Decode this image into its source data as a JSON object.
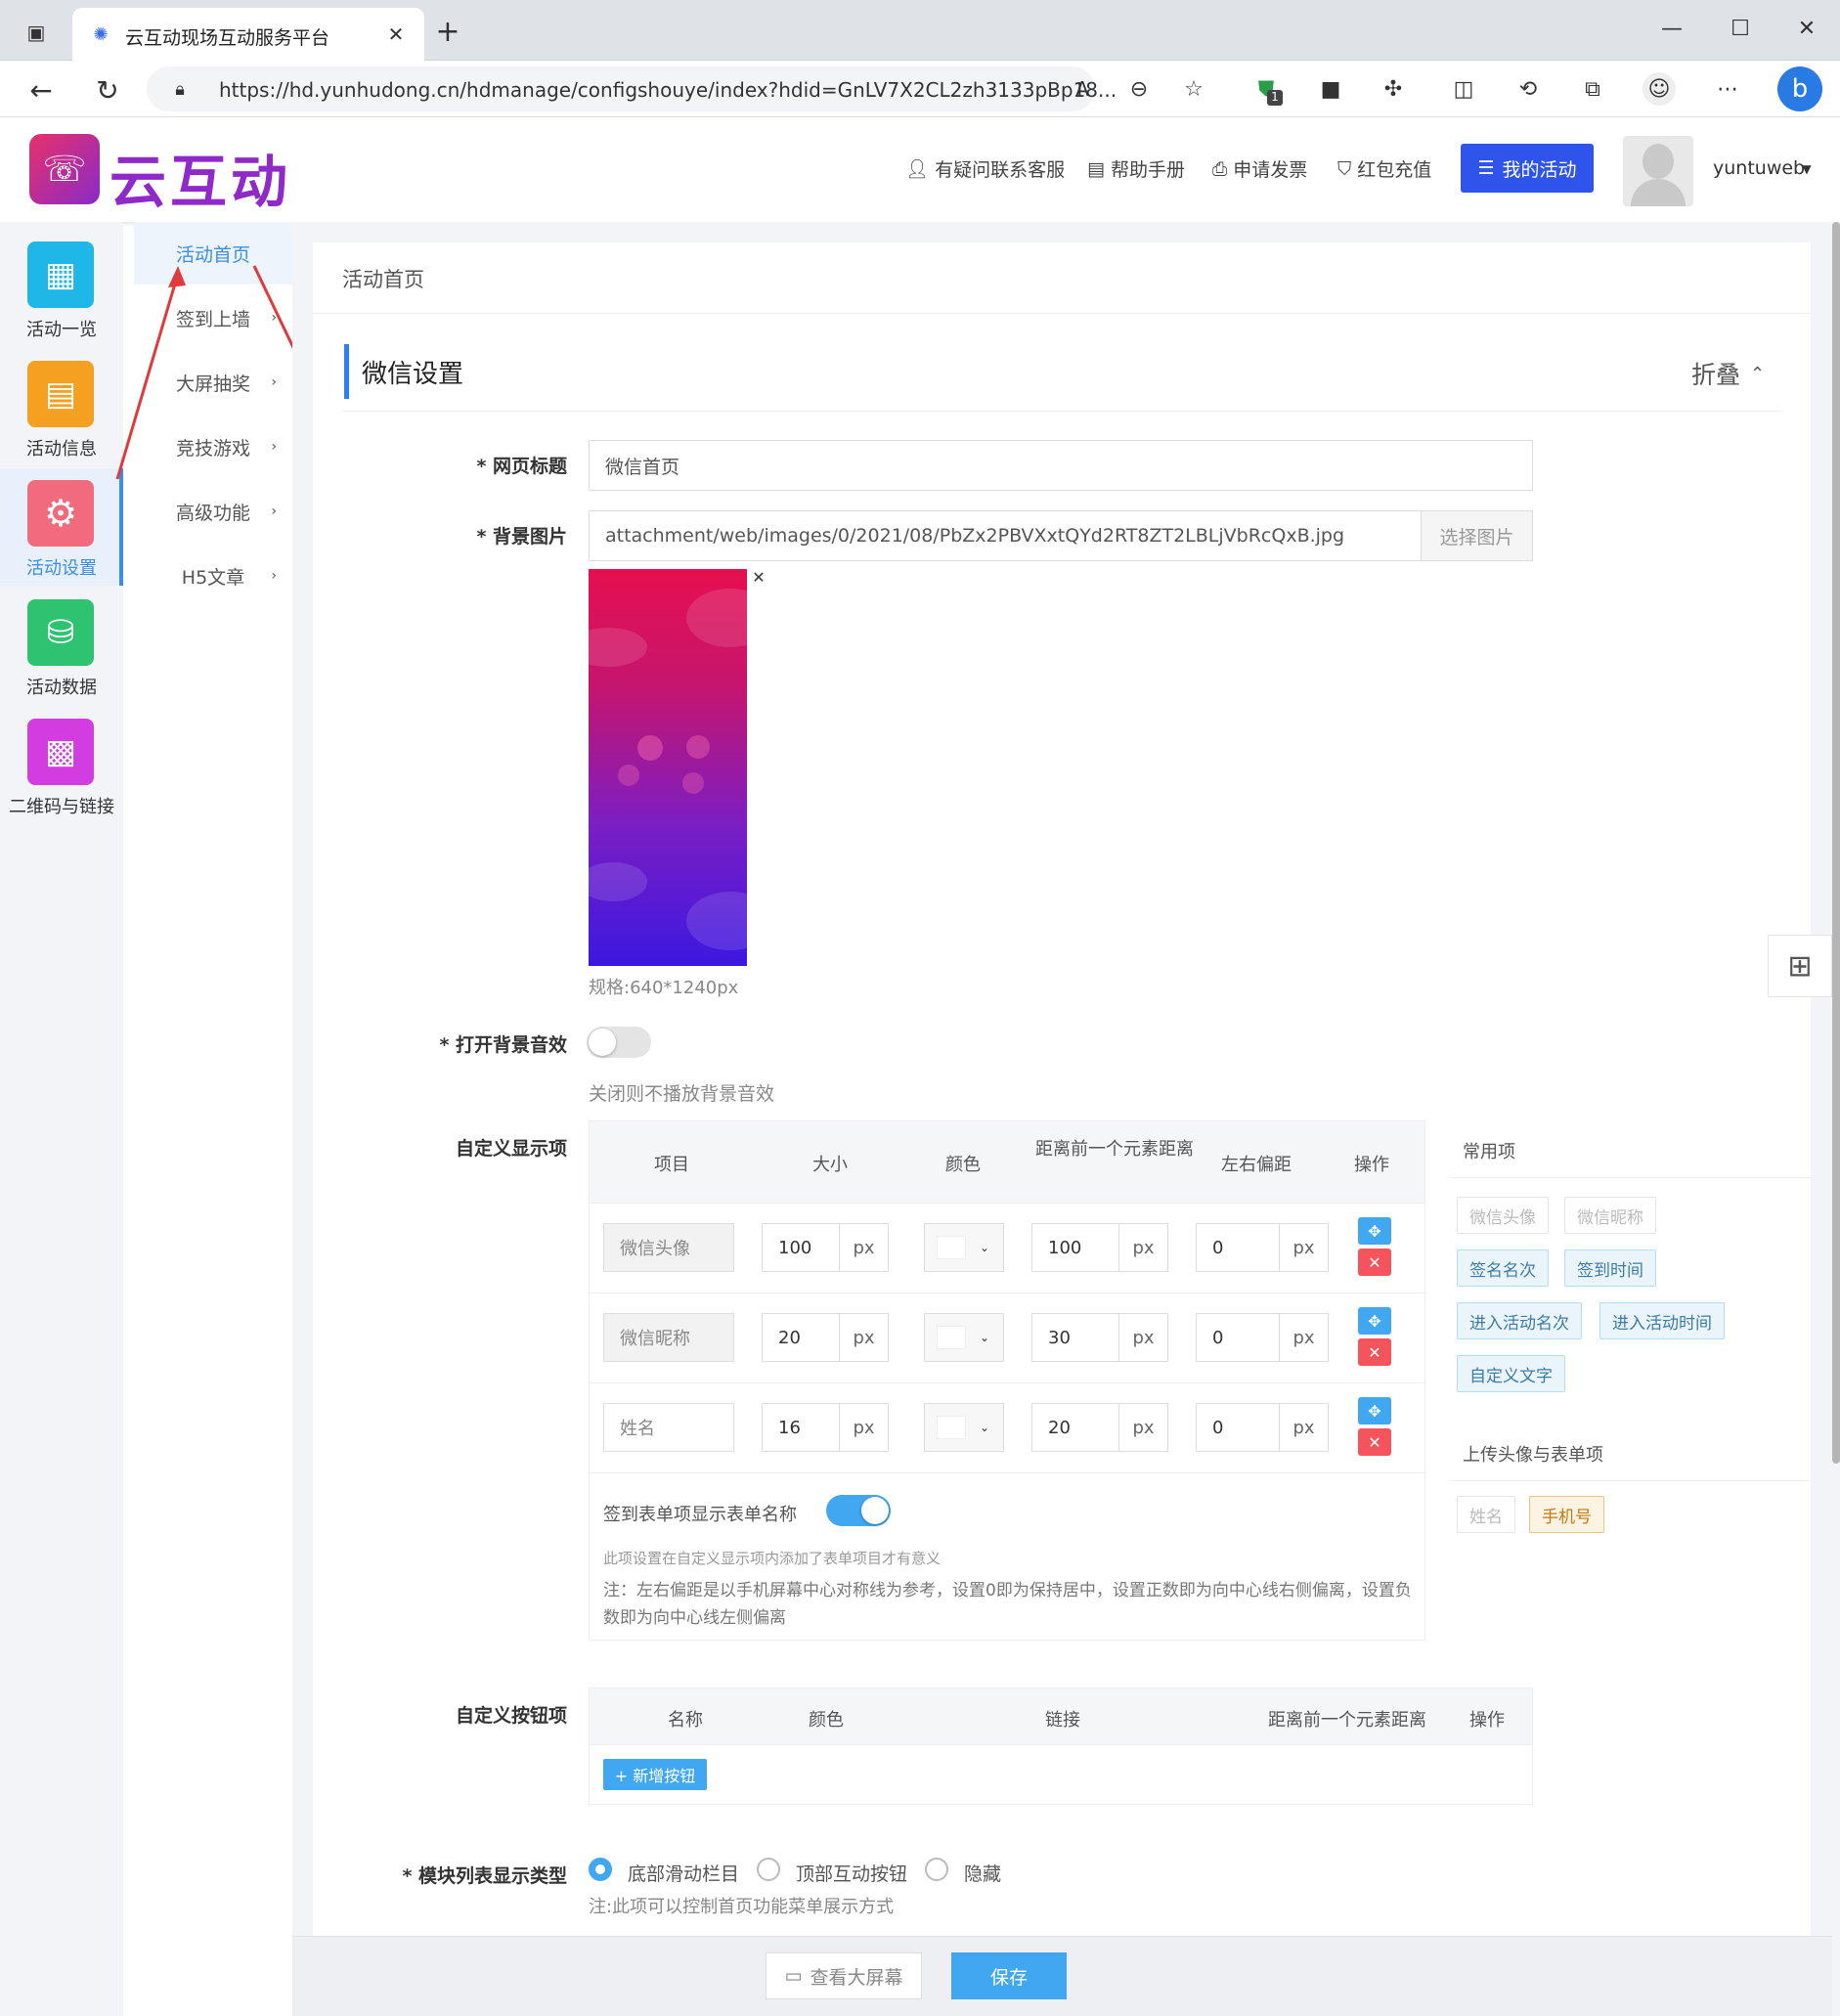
{
  "browser": {
    "tab_title": "云互动现场互动服务平台",
    "url": "https://hd.yunhudong.cn/hdmanage/configshouye/index?hdid=GnLV7X2CL2zh3133pBp18...",
    "extension_badge": "1"
  },
  "header": {
    "logo_text": "云互动",
    "links": [
      "有疑问联系客服",
      "帮助手册",
      "申请发票",
      "红包充值"
    ],
    "my_activity": "我的活动",
    "username": "yuntuweb"
  },
  "leftnav": {
    "items": [
      {
        "label": "活动一览",
        "color": "#1fb7e8"
      },
      {
        "label": "活动信息",
        "color": "#f5a020"
      },
      {
        "label": "活动设置",
        "color": "#f26b7d"
      },
      {
        "label": "活动数据",
        "color": "#2ec371"
      },
      {
        "label": "二维码与链接",
        "color": "#d23ce0"
      }
    ],
    "active_index": 2
  },
  "subnav": {
    "items": [
      "活动首页",
      "签到上墙",
      "大屏抽奖",
      "竞技游戏",
      "高级功能",
      "H5文章"
    ]
  },
  "main": {
    "breadcrumb": "活动首页",
    "section_title": "微信设置",
    "collapse_label": "折叠",
    "page_title_label": "* 网页标题",
    "page_title_value": "微信首页",
    "bg_label": "* 背景图片",
    "bg_value": "attachment/web/images/0/2021/08/PbZx2PBVXxtQYd2RT8ZT2LBLjVbRcQxB.jpg",
    "bg_button": "选择图片",
    "bg_spec": "规格:640*1240px",
    "music_label": "* 打开背景音效",
    "music_hint": "关闭则不播放背景音效",
    "music_on": false,
    "custom_label": "自定义显示项",
    "custom_headers": [
      "项目",
      "大小",
      "颜色",
      "距离前一个元素距离",
      "左右偏距",
      "操作"
    ],
    "custom_rows": [
      {
        "item": "微信头像",
        "size": "100",
        "dist": "100",
        "offset": "0",
        "locked": true
      },
      {
        "item": "微信昵称",
        "size": "20",
        "dist": "30",
        "offset": "0",
        "locked": true
      },
      {
        "item": "姓名",
        "size": "16",
        "dist": "20",
        "offset": "0",
        "locked": false
      }
    ],
    "unit": "px",
    "form_name_label": "签到表单项显示表单名称",
    "form_name_on": true,
    "form_name_hint": "此项设置在自定义显示项内添加了表单项目才有意义",
    "note": "注：左右偏距是以手机屏幕中心对称线为参考，设置0即为保持居中，设置正数即为向中心线右侧偏离，设置负数即为向中心线左侧偏离",
    "common_title": "常用项",
    "common_tags": [
      {
        "label": "微信头像",
        "state": "disabled"
      },
      {
        "label": "微信昵称",
        "state": "disabled"
      },
      {
        "label": "签名名次",
        "state": "normal"
      },
      {
        "label": "签到时间",
        "state": "normal"
      },
      {
        "label": "进入活动名次",
        "state": "normal"
      },
      {
        "label": "进入活动时间",
        "state": "normal"
      },
      {
        "label": "自定义文字",
        "state": "normal"
      }
    ],
    "upload_title": "上传头像与表单项",
    "upload_tags": [
      {
        "label": "姓名",
        "state": "disabled"
      },
      {
        "label": "手机号",
        "state": "warn"
      }
    ],
    "button_label": "自定义按钮项",
    "button_headers": [
      "名称",
      "颜色",
      "链接",
      "距离前一个元素距离",
      "操作"
    ],
    "add_button": "+ 新增按钮",
    "module_label": "* 模块列表显示类型",
    "module_options": [
      "底部滑动栏目",
      "顶部互动按钮",
      "隐藏"
    ],
    "module_selected": 0,
    "module_hint": "注:此项可以控制首页功能菜单展示方式",
    "view_screen": "查看大屏幕",
    "save": "保存"
  },
  "colors": {
    "primary": "#2f7df6",
    "accent_blue": "#41a7f0",
    "danger": "#f5545c"
  }
}
